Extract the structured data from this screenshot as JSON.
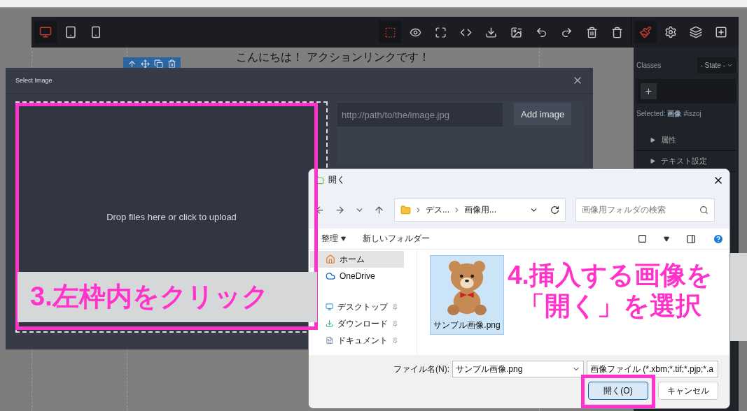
{
  "editor": {
    "device_buttons": [
      {
        "kind": "desktop",
        "selected": true
      },
      {
        "kind": "tablet",
        "selected": false
      },
      {
        "kind": "mobile",
        "selected": false
      }
    ],
    "tool_buttons": [
      {
        "kind": "outline",
        "selected": true
      },
      {
        "kind": "preview",
        "selected": false
      },
      {
        "kind": "fullscreen",
        "selected": false
      },
      {
        "kind": "code",
        "selected": false
      },
      {
        "kind": "export",
        "selected": false
      },
      {
        "kind": "image-clear",
        "selected": false
      },
      {
        "kind": "undo",
        "selected": false
      },
      {
        "kind": "redo",
        "selected": false
      },
      {
        "kind": "delete",
        "selected": false
      },
      {
        "kind": "clear",
        "selected": false
      }
    ],
    "panel_buttons": [
      {
        "kind": "style",
        "selected": true
      },
      {
        "kind": "settings",
        "selected": false
      },
      {
        "kind": "layers",
        "selected": false
      },
      {
        "kind": "blocks",
        "selected": false
      }
    ],
    "canvas_text": "こんにちは！ アクションリンクです！",
    "style_panel": {
      "classes_label": "Classes",
      "state_select": "- State -",
      "add_class": "+",
      "selected_label": "Selected:",
      "selected_name": "画像",
      "selected_id": "#iszoj",
      "sections": [
        "属性",
        "テキスト設定"
      ]
    }
  },
  "modal": {
    "title": "Select Image",
    "dropzone_text": "Drop files here or click to upload",
    "url_placeholder": "http://path/to/the/image.jpg",
    "add_button": "Add image"
  },
  "file_dialog": {
    "title": "開く",
    "breadcrumb": [
      "デス...",
      "画像用..."
    ],
    "search_placeholder": "画像用フォルダの検索",
    "organize": "整理",
    "new_folder": "新しいフォルダー",
    "nav_items": [
      {
        "kind": "home",
        "label": "ホーム",
        "selected": true,
        "pinned": false
      },
      {
        "kind": "cloud",
        "label": "OneDrive",
        "selected": false,
        "pinned": false
      },
      {
        "kind": "desktop",
        "label": "デスクトップ",
        "selected": false,
        "pinned": true
      },
      {
        "kind": "download",
        "label": "ダウンロード",
        "selected": false,
        "pinned": true
      },
      {
        "kind": "document",
        "label": "ドキュメント",
        "selected": false,
        "pinned": true
      }
    ],
    "files": [
      {
        "name": "サンプル画像.png",
        "selected": true
      }
    ],
    "filename_label": "ファイル名(N):",
    "filename_value": "サンプル画像.png",
    "filter": "画像ファイル (*.xbm;*.tif;*.pjp;*.a",
    "open_button": "開く(O)",
    "cancel_button": "キャンセル"
  },
  "annotations": [
    {
      "kind": "band",
      "lines": [
        "3.左枠内をクリック"
      ]
    },
    {
      "kind": "plain",
      "lines": [
        "4.挿入する画像を",
        "「開く」を選択"
      ]
    }
  ]
}
